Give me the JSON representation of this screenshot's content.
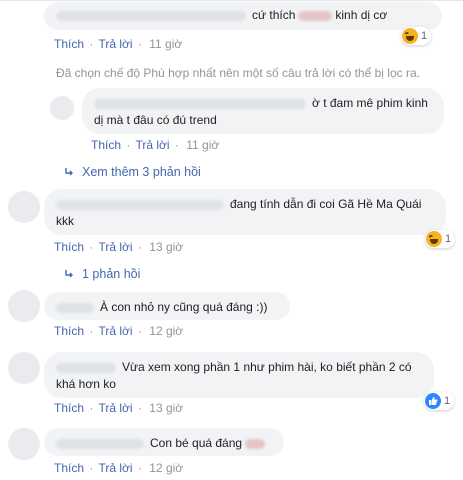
{
  "ui": {
    "like": "Thích",
    "reply": "Trả lời",
    "dot": "·"
  },
  "filter_note": "Đã chọn chế độ Phù hợp nhất nên một số câu trả lời có thể bị lọc ra.",
  "comments": [
    {
      "text": "cứ thích",
      "text_after": "kinh dị cơ",
      "time": "11 giờ",
      "reaction": {
        "icon": "haha-emoji-icon",
        "count": "1"
      }
    },
    {
      "text_line1": "ờ t đam mê phim kinh",
      "text_line2": "dị mà t đâu có đú trend",
      "time": "11 giờ"
    },
    {
      "more_replies": "Xem thêm 3 phản hồi"
    },
    {
      "text_line1": "đang tính dẫn đi coi Gã Hề Ma Quái",
      "text_line2": "kkk",
      "time": "13 giờ",
      "reaction": {
        "icon": "haha-emoji-icon",
        "count": "1"
      },
      "replies_link": "1 phản hồi"
    },
    {
      "text": "À con nhỏ ny cũng quá đáng :))",
      "time": "12 giờ"
    },
    {
      "text_line1": "Vừa xem xong phần 1 như phim hài, ko biết phần 2 có",
      "text_line2": "khá hơn ko",
      "time": "13 giờ",
      "reaction": {
        "icon": "like-thumb-icon",
        "count": "1"
      }
    },
    {
      "text": "Con bé quá đáng",
      "time": "12 giờ"
    }
  ],
  "colors": {
    "link": "#4267b2",
    "muted": "#90949c",
    "bubble": "#f2f3f5",
    "haha": "#f7b125",
    "like": "#2d86ff"
  }
}
